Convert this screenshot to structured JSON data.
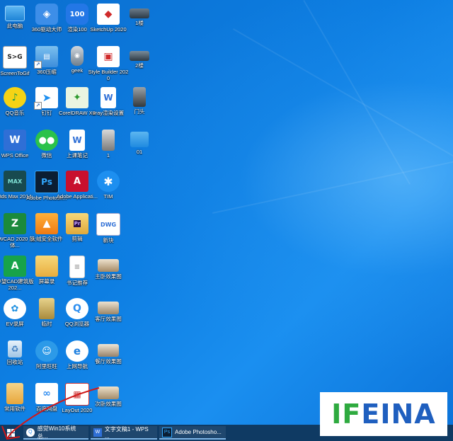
{
  "desktop": {
    "icons": [
      {
        "label": "此电脑"
      },
      {
        "label": "360驱动大师"
      },
      {
        "label": "渲染100",
        "text": "100"
      },
      {
        "label": "SketchUp 2020"
      },
      {
        "label": "1楼"
      },
      {
        "label": "ScreenToGif",
        "text": "S>G"
      },
      {
        "label": "360压缩"
      },
      {
        "label": "geek"
      },
      {
        "label": "Style Builder 2020"
      },
      {
        "label": "2楼"
      },
      {
        "label": "QQ音乐"
      },
      {
        "label": "钉钉"
      },
      {
        "label": "CorelDRAW X8"
      },
      {
        "label": "vray渲染设置"
      },
      {
        "label": "门头"
      },
      {
        "label": "WPS Office",
        "text": "W"
      },
      {
        "label": "微信"
      },
      {
        "label": "上课笔记"
      },
      {
        "label": "1"
      },
      {
        "label": "01"
      },
      {
        "label": "3ds Max 2014",
        "text": "MAX"
      },
      {
        "label": "Adobe Photosh...",
        "text": "Ps"
      },
      {
        "label": "Adobe Applicati..."
      },
      {
        "label": "TIM"
      },
      {
        "label": "ZWCAD 2020 简体..."
      },
      {
        "label": "火绒安全软件"
      },
      {
        "label": "剪辑"
      },
      {
        "label": "新块",
        "text": "DWG"
      },
      {
        "label": "中望CAD建筑版 202..."
      },
      {
        "label": "屏幕录"
      },
      {
        "label": "书记推荐"
      },
      {
        "label": "主卧效果图"
      },
      {
        "label": "EV录屏"
      },
      {
        "label": "临时"
      },
      {
        "label": "QQ浏览器"
      },
      {
        "label": "客厅效果图"
      },
      {
        "label": "回收站"
      },
      {
        "label": "阿里旺旺"
      },
      {
        "label": "上网导航"
      },
      {
        "label": "餐厅效果图"
      },
      {
        "label": "常用软件"
      },
      {
        "label": "百度网盘"
      },
      {
        "label": "LayOut 2020"
      },
      {
        "label": "次卧效果图"
      }
    ]
  },
  "taskbar": {
    "tasks": [
      {
        "label": "感觉Win10系统总..."
      },
      {
        "label": "文字文稿1 - WPS ...",
        "text": "W"
      },
      {
        "label": "Adobe Photosho...",
        "text": "Ps"
      }
    ]
  },
  "watermark": {
    "text": "IFEINA"
  },
  "colors": {
    "accent": "#0a74d6",
    "taskbar": "#0f3a63",
    "watermark_green": "#2eaa3f",
    "watermark_blue": "#1f5fbf"
  }
}
